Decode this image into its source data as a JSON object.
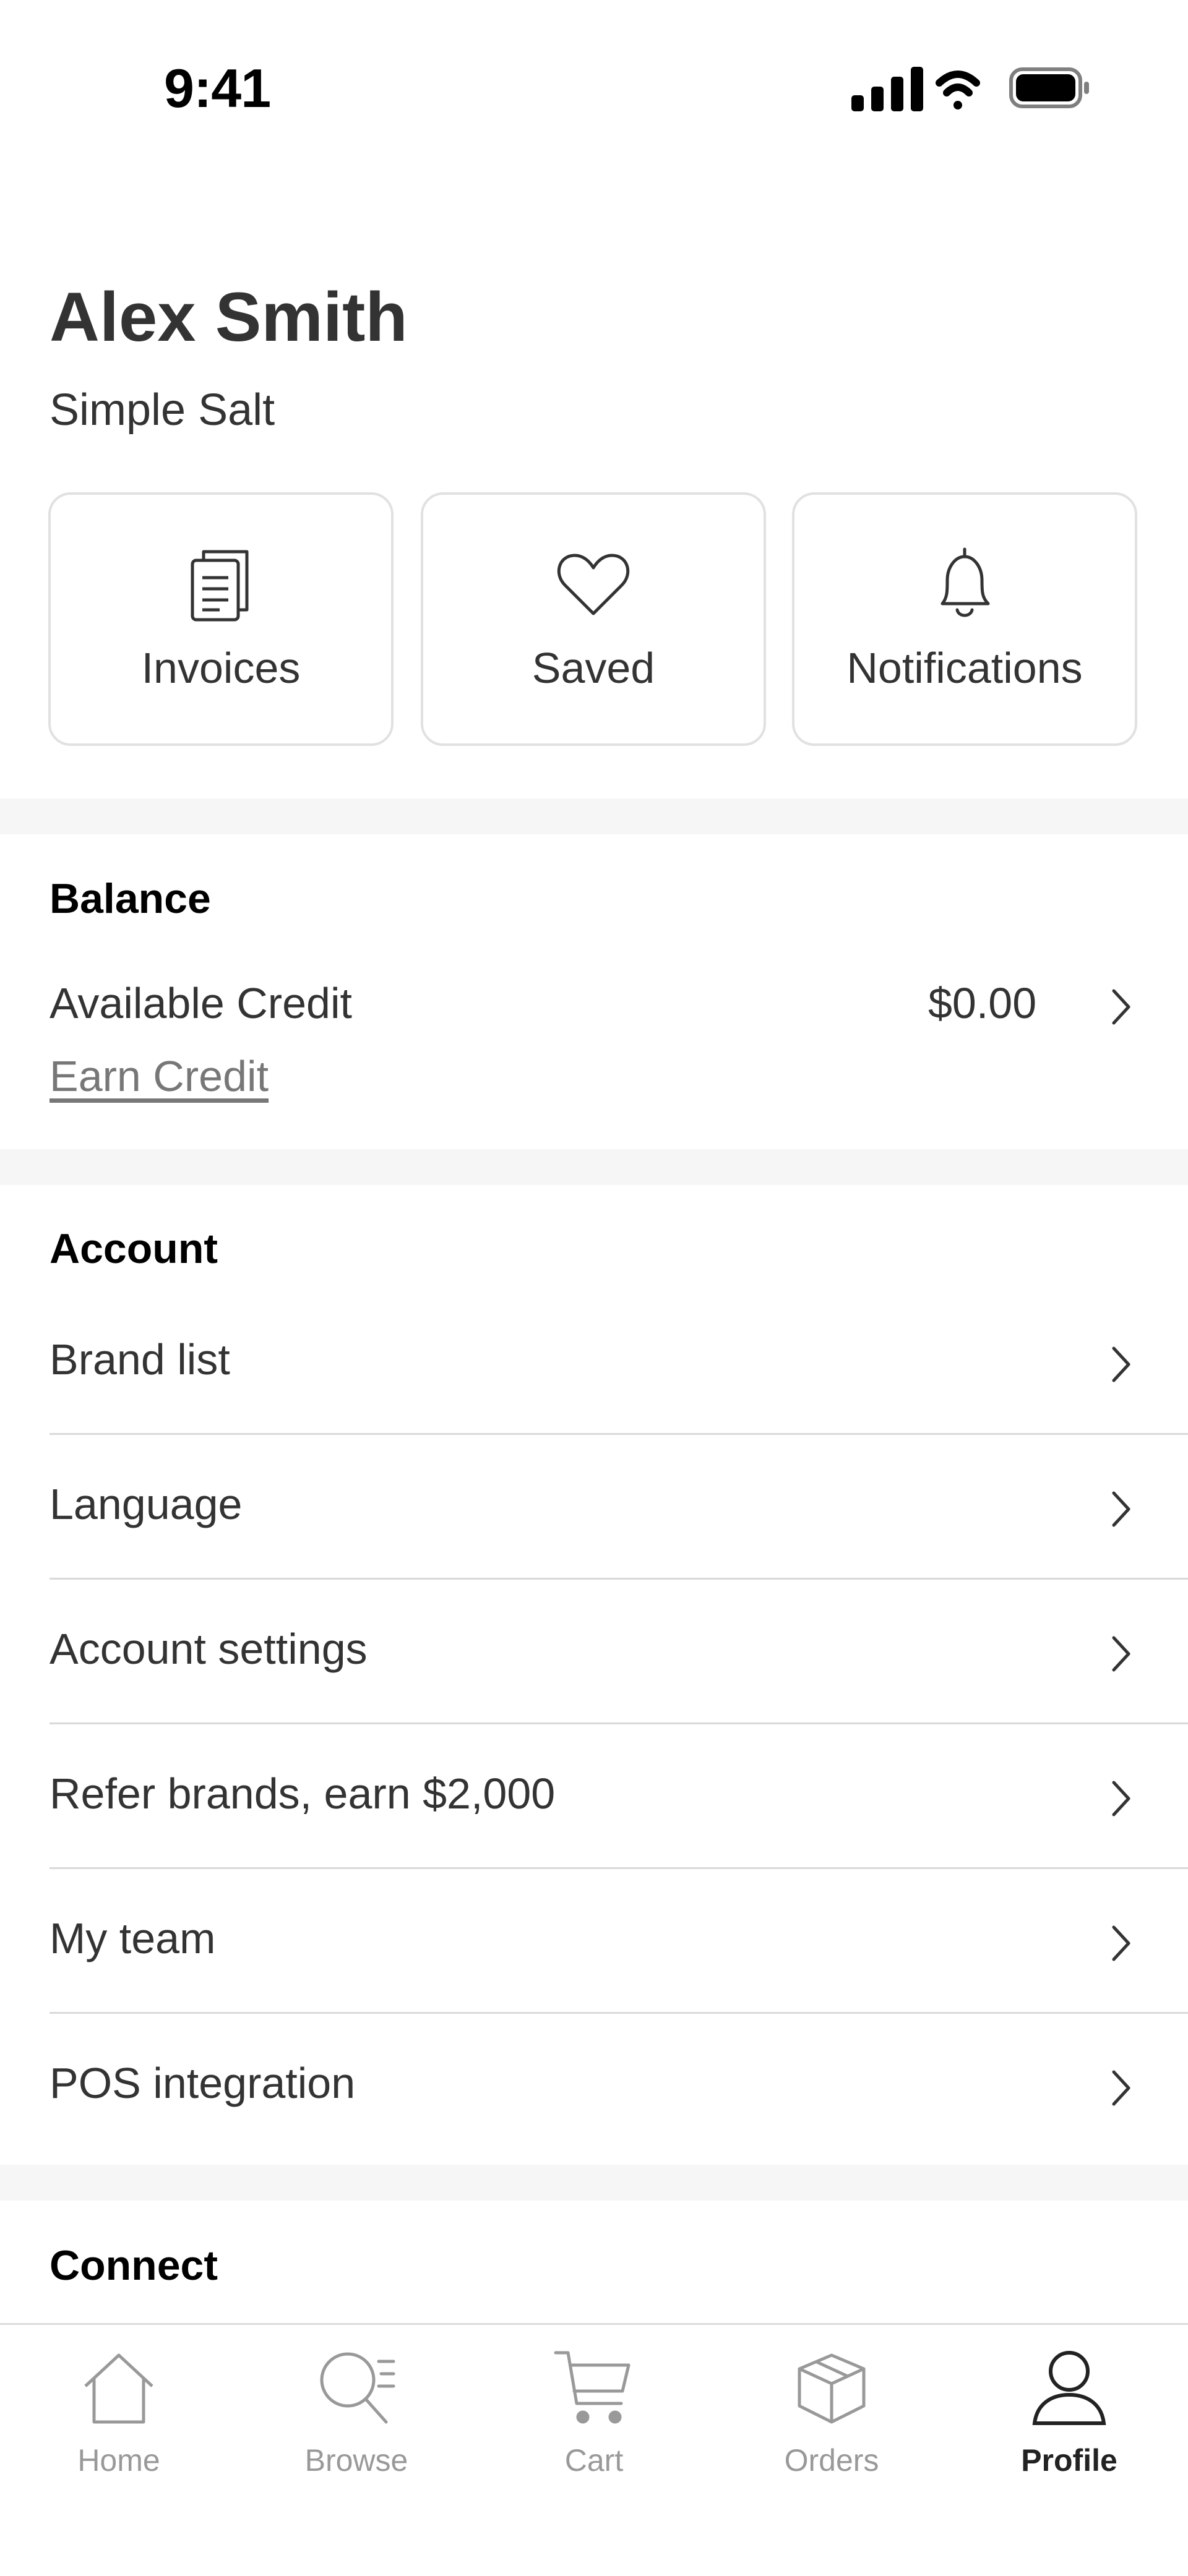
{
  "status_bar": {
    "time": "9:41"
  },
  "header": {
    "name": "Alex Smith",
    "store": "Simple Salt"
  },
  "quick_actions": [
    {
      "label": "Invoices",
      "icon": "document-icon"
    },
    {
      "label": "Saved",
      "icon": "heart-icon"
    },
    {
      "label": "Notifications",
      "icon": "bell-icon"
    }
  ],
  "balance": {
    "title": "Balance",
    "available_label": "Available Credit",
    "available_value": "$0.00",
    "earn_link": "Earn Credit"
  },
  "account": {
    "title": "Account",
    "items": [
      {
        "label": "Brand list"
      },
      {
        "label": "Language"
      },
      {
        "label": "Account settings"
      },
      {
        "label": "Refer brands, earn $2,000"
      },
      {
        "label": "My team"
      },
      {
        "label": "POS integration"
      }
    ]
  },
  "connect": {
    "title": "Connect"
  },
  "tab_bar": {
    "items": [
      {
        "label": "Home",
        "icon": "home-icon"
      },
      {
        "label": "Browse",
        "icon": "search-icon"
      },
      {
        "label": "Cart",
        "icon": "cart-icon"
      },
      {
        "label": "Orders",
        "icon": "box-icon"
      },
      {
        "label": "Profile",
        "icon": "person-icon"
      }
    ],
    "active": "Profile"
  },
  "colors": {
    "text": "#333333",
    "muted": "#999999",
    "border": "#e1e1e1",
    "band": "#f6f6f6"
  }
}
